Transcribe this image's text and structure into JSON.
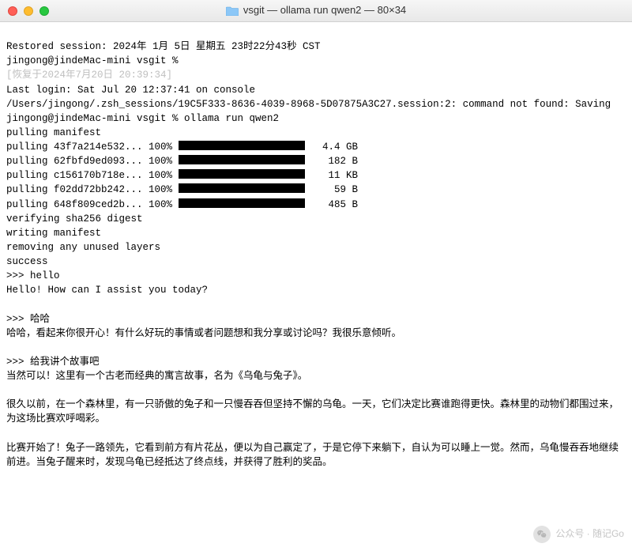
{
  "window": {
    "title": "vsgit — ollama run qwen2 — 80×34"
  },
  "session": {
    "restored": "Restored session: 2024年 1月 5日 星期五 23时22分43秒 CST",
    "prompt1": "jingong@jindeMac-mini vsgit %",
    "recovery_hint": "[恢复于2024年7月20日 20:39:34]",
    "last_login": "Last login: Sat Jul 20 12:37:41 on console",
    "error_line": "/Users/jingong/.zsh_sessions/19C5F333-8636-4039-8968-5D07875A3C27.session:2: command not found: Saving",
    "run_cmd": "jingong@jindeMac-mini vsgit % ollama run qwen2"
  },
  "pull": {
    "manifest": "pulling manifest",
    "rows": [
      {
        "hash": "43f7a214e532",
        "pct": "100%",
        "size": "4.4 GB"
      },
      {
        "hash": "62fbfd9ed093",
        "pct": "100%",
        "size": "182 B"
      },
      {
        "hash": "c156170b718e",
        "pct": "100%",
        "size": "11 KB"
      },
      {
        "hash": "f02dd72bb242",
        "pct": "100%",
        "size": "59 B"
      },
      {
        "hash": "648f809ced2b",
        "pct": "100%",
        "size": "485 B"
      }
    ],
    "verify": "verifying sha256 digest",
    "writing": "writing manifest",
    "removing": "removing any unused layers",
    "success": "success"
  },
  "chat": {
    "p1": ">>> hello",
    "r1": "Hello! How can I assist you today?",
    "p2": ">>> 哈哈",
    "r2": "哈哈，看起来你很开心！有什么好玩的事情或者问题想和我分享或讨论吗？我很乐意倾听。",
    "p3": ">>> 给我讲个故事吧",
    "r3a": "当然可以！这里有一个古老而经典的寓言故事，名为《乌龟与兔子》。",
    "r3b": "很久以前，在一个森林里，有一只骄傲的兔子和一只慢吞吞但坚持不懈的乌龟。一天，它们决定比赛谁跑得更快。森林里的动物们都围过来，为这场比赛欢呼喝彩。",
    "r3c": "比赛开始了！兔子一路领先，它看到前方有片花丛，便以为自己赢定了，于是它停下来躺下，自认为可以睡上一觉。然而，乌龟慢吞吞地继续前进。当兔子醒来时，发现乌龟已经抵达了终点线，并获得了胜利的奖品。"
  },
  "watermark": {
    "text": "公众号 · 随记Go"
  }
}
